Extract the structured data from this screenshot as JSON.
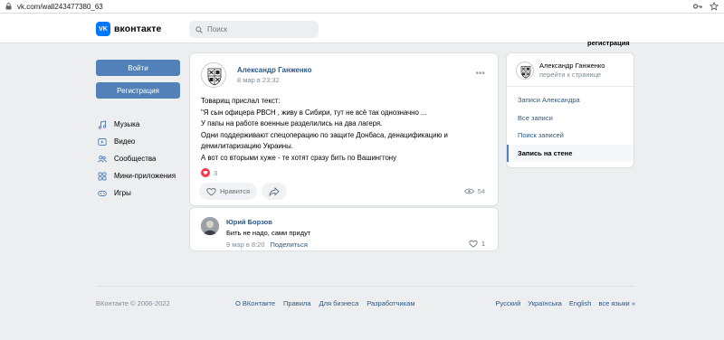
{
  "browser": {
    "url": "vk.com/wall243477380_63",
    "icons": [
      "lock-icon",
      "key-icon",
      "star-icon"
    ]
  },
  "header": {
    "logo_mark": "VK",
    "logo_text": "вконтакте",
    "search_placeholder": "Поиск",
    "register_link": "регистрация"
  },
  "left": {
    "login_button": "Войти",
    "register_button": "Регистрация",
    "nav": [
      {
        "label": "Музыка",
        "icon": "music-icon"
      },
      {
        "label": "Видео",
        "icon": "video-icon"
      },
      {
        "label": "Сообщества",
        "icon": "communities-icon"
      },
      {
        "label": "Мини-приложения",
        "icon": "apps-icon"
      },
      {
        "label": "Игры",
        "icon": "games-icon"
      }
    ]
  },
  "post": {
    "author": "Александр Ганженко",
    "date": "8 мар в 23:32",
    "more": "•••",
    "text_lines": [
      "Товарищ прислал текст:",
      "\"Я сын офицера РВСН , живу в Сибири, тут не всё так однозначно ...",
      "У папы на работе военные разделились на два лагеря.",
      "Одни поддерживают спецоперацию по защите Донбаса, денацификацию и",
      "демилитаризацию Украины.",
      "А вот со вторыми хуже - те хотят сразу бить по Вашингтону"
    ],
    "reactions_count": "3",
    "like_label": "Нравится",
    "views": "54"
  },
  "comment": {
    "author": "Юрий Борзов",
    "text": "Бить не надо, сами придут",
    "date": "9 мар в 8:20",
    "share": "Поделиться",
    "likes": "1"
  },
  "right": {
    "owner_name": "Александр Ганженко",
    "owner_sub": "перейти к странице",
    "menu": [
      {
        "label": "Записи Александра",
        "active": false
      },
      {
        "label": "Все записи",
        "active": false
      },
      {
        "label": "Поиск записей",
        "active": false
      },
      {
        "label": "Запись на стене",
        "active": true
      }
    ]
  },
  "footer": {
    "copyright": "ВКонтакте © 2006-2022",
    "links": [
      "О ВКонтакте",
      "Правила",
      "Для бизнеса",
      "Разработчикам"
    ],
    "languages": [
      "Русский",
      "Українська",
      "English",
      "все языки »"
    ]
  },
  "colors": {
    "accent": "#5181b8",
    "link": "#2a5885",
    "background": "#edeef0",
    "reaction": "#ff3347"
  }
}
